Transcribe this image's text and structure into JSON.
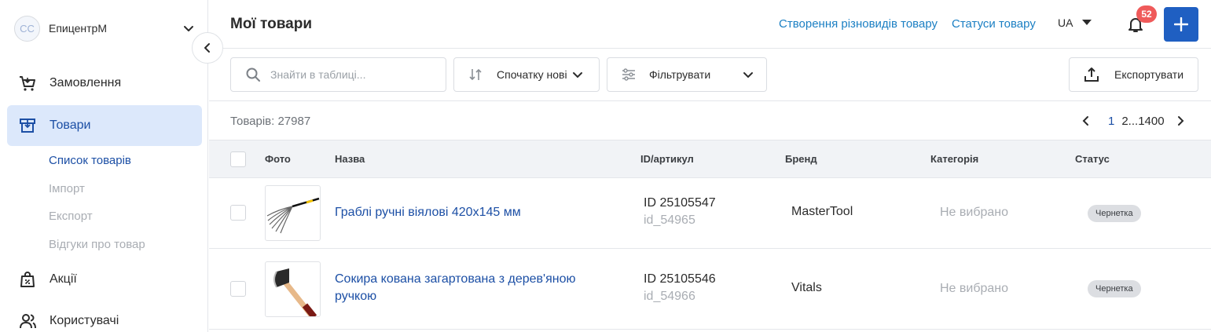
{
  "sidebar": {
    "account": {
      "initials": "CC",
      "name": "ЕпицентрМ"
    },
    "items": [
      {
        "label": "Замовлення"
      },
      {
        "label": "Товари"
      },
      {
        "label": "Акції"
      },
      {
        "label": "Користувачі"
      }
    ],
    "subitems": [
      {
        "label": "Список товарів"
      },
      {
        "label": "Імпорт"
      },
      {
        "label": "Експорт"
      },
      {
        "label": "Відгуки про товар"
      }
    ]
  },
  "header": {
    "title": "Мої товари",
    "link_variants": "Створення різновидів товару",
    "link_statuses": "Статуси товару",
    "lang": "UA",
    "notifications": "52",
    "add_label": "+"
  },
  "toolbar": {
    "search_placeholder": "Знайти в таблиці...",
    "sort_label": "Спочатку нові",
    "filter_label": "Фільтрувати",
    "export_label": "Експортувати"
  },
  "list": {
    "count": "Товарів: 27987",
    "page_current": "1",
    "page_rest": "2...1400"
  },
  "table": {
    "columns": [
      "Фото",
      "Назва",
      "ID/артикул",
      "Бренд",
      "Категорія",
      "Статус"
    ],
    "rows": [
      {
        "name": "Граблі ручні віялові 420х145 мм",
        "id": "ID 25105547",
        "sku": "id_54965",
        "brand": "MasterTool",
        "category": "Не вибрано",
        "status": "Чернетка",
        "photo": "rake-image"
      },
      {
        "name": "Сокира кована загартована з дерев'яною ручкою",
        "id": "ID 25105546",
        "sku": "id_54966",
        "brand": "Vitals",
        "category": "Не вибрано",
        "status": "Чернетка",
        "photo": "axe-image"
      }
    ]
  },
  "colors": {
    "accent": "#1f5fc2",
    "link": "#1b7fc3",
    "active_bg": "#dce8fb",
    "badge": "#ef5a5a"
  }
}
